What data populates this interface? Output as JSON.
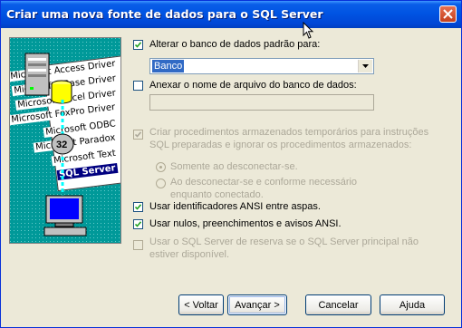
{
  "window": {
    "title": "Criar uma nova fonte de dados para o SQL Server"
  },
  "illustration": {
    "tags": [
      "Microsoft Access Driver",
      "Microsoft dBase Driver",
      "Microsoft Excel Driver",
      "Microsoft FoxPro Driver",
      "Microsoft ODBC",
      "Microsoft Paradox",
      "Microsoft Text",
      "SQL Server"
    ],
    "badge": "32"
  },
  "options": {
    "change_default_db": {
      "label": "Alterar o banco de dados padrão para:",
      "checked": true
    },
    "database_combo": {
      "value": "Banco"
    },
    "attach_db_file": {
      "label": "Anexar o nome de arquivo do banco de dados:",
      "checked": false
    },
    "attach_db_path": {
      "value": ""
    },
    "create_temp_procs": {
      "label": "Criar procedimentos armazenados temporários para instruções SQL preparadas e ignorar os procedimentos armazenados:",
      "checked": true,
      "enabled": false
    },
    "only_disconnect": {
      "label": "Somente ao desconectar-se.",
      "selected": true,
      "enabled": false
    },
    "on_disconnect_and_connected": {
      "label": "Ao desconectar-se e conforme necessário enquanto conectado.",
      "selected": false,
      "enabled": false
    },
    "ansi_quoted_ids": {
      "label": "Usar identificadores ANSI entre aspas.",
      "checked": true
    },
    "ansi_nulls": {
      "label": "Usar nulos, preenchimentos e avisos ANSI.",
      "checked": true
    },
    "failover_server": {
      "label": "Usar o SQL Server de reserva se o SQL Server principal não estiver disponível.",
      "checked": false,
      "enabled": false
    }
  },
  "buttons": {
    "back": "< Voltar",
    "next": "Avançar >",
    "cancel": "Cancelar",
    "help": "Ajuda"
  }
}
